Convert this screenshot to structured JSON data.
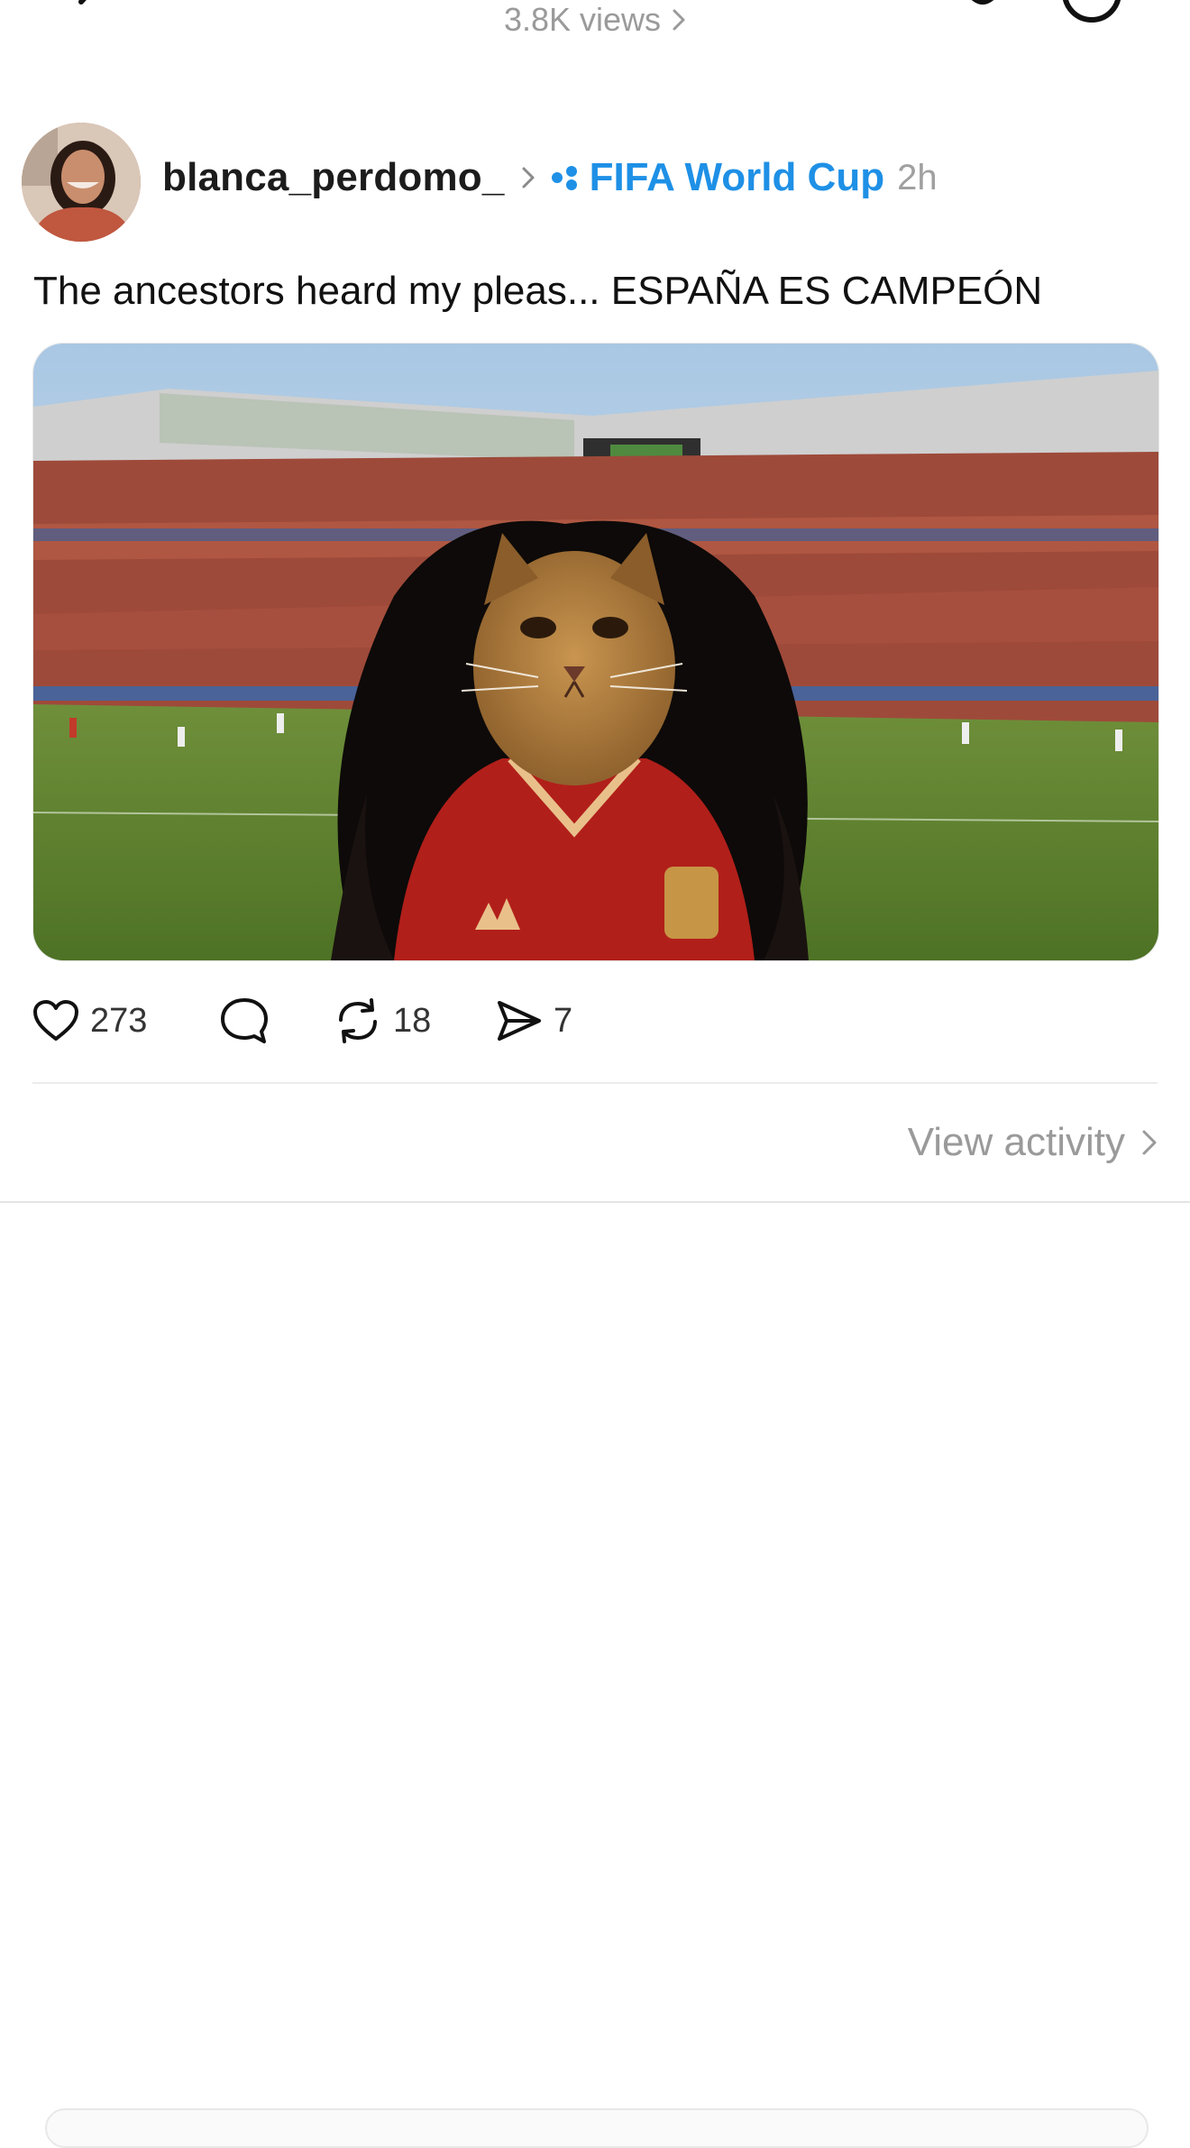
{
  "topbar": {
    "views_text": "3.8K views",
    "icons": [
      "back-chevron-icon",
      "bell-icon",
      "more-icon"
    ]
  },
  "post": {
    "username": "blanca_perdomo_",
    "community": "FIFA World Cup",
    "time": "2h",
    "text": "The ancestors heard my pleas... ESPAÑA ES CAMPEÓN",
    "media_description": "cat with long curly hair in Spain jersey in stadium"
  },
  "actions": {
    "likes": "273",
    "reposts": "18",
    "shares": "7"
  },
  "activity": {
    "label": "View activity"
  },
  "colors": {
    "accent": "#1e90e6",
    "muted": "#9a9a9a",
    "text": "#111111"
  }
}
